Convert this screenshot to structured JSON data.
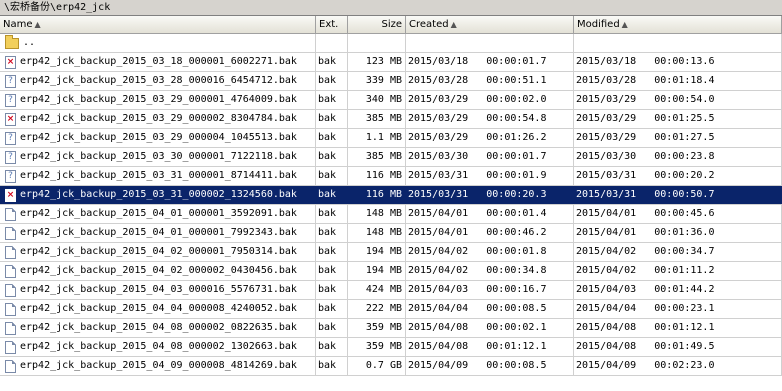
{
  "path": "\\宏桥备份\\erp42_jck",
  "headers": {
    "name": "Name",
    "ext": "Ext.",
    "size": "Size",
    "created": "Created",
    "modified": "Modified"
  },
  "up_dir": "..",
  "rows": [
    {
      "icon": "error-file-icon",
      "name": "erp42_jck_backup_2015_03_18_000001_6002271.bak",
      "ext": "bak",
      "size": "123 MB",
      "created": "2015/03/18   00:00:01.7",
      "modified": "2015/03/18   00:00:13.6"
    },
    {
      "icon": "unknown-file-icon",
      "name": "erp42_jck_backup_2015_03_28_000016_6454712.bak",
      "ext": "bak",
      "size": "339 MB",
      "created": "2015/03/28   00:00:51.1",
      "modified": "2015/03/28   00:01:18.4"
    },
    {
      "icon": "unknown-file-icon",
      "name": "erp42_jck_backup_2015_03_29_000001_4764009.bak",
      "ext": "bak",
      "size": "340 MB",
      "created": "2015/03/29   00:00:02.0",
      "modified": "2015/03/29   00:00:54.0"
    },
    {
      "icon": "error-file-icon",
      "name": "erp42_jck_backup_2015_03_29_000002_8304784.bak",
      "ext": "bak",
      "size": "385 MB",
      "created": "2015/03/29   00:00:54.8",
      "modified": "2015/03/29   00:01:25.5"
    },
    {
      "icon": "unknown-file-icon",
      "name": "erp42_jck_backup_2015_03_29_000004_1045513.bak",
      "ext": "bak",
      "size": "1.1 MB",
      "created": "2015/03/29   00:01:26.2",
      "modified": "2015/03/29   00:01:27.5"
    },
    {
      "icon": "unknown-file-icon",
      "name": "erp42_jck_backup_2015_03_30_000001_7122118.bak",
      "ext": "bak",
      "size": "385 MB",
      "created": "2015/03/30   00:00:01.7",
      "modified": "2015/03/30   00:00:23.8"
    },
    {
      "icon": "unknown-file-icon",
      "name": "erp42_jck_backup_2015_03_31_000001_8714411.bak",
      "ext": "bak",
      "size": "116 MB",
      "created": "2015/03/31   00:00:01.9",
      "modified": "2015/03/31   00:00:20.2"
    },
    {
      "icon": "error-file-icon",
      "name": "erp42_jck_backup_2015_03_31_000002_1324560.bak",
      "ext": "bak",
      "size": "116 MB",
      "created": "2015/03/31   00:00:20.3",
      "modified": "2015/03/31   00:00:50.7",
      "selected": true
    },
    {
      "icon": "file-icon",
      "name": "erp42_jck_backup_2015_04_01_000001_3592091.bak",
      "ext": "bak",
      "size": "148 MB",
      "created": "2015/04/01   00:00:01.4",
      "modified": "2015/04/01   00:00:45.6"
    },
    {
      "icon": "file-icon",
      "name": "erp42_jck_backup_2015_04_01_000001_7992343.bak",
      "ext": "bak",
      "size": "148 MB",
      "created": "2015/04/01   00:00:46.2",
      "modified": "2015/04/01   00:01:36.0"
    },
    {
      "icon": "file-icon",
      "name": "erp42_jck_backup_2015_04_02_000001_7950314.bak",
      "ext": "bak",
      "size": "194 MB",
      "created": "2015/04/02   00:00:01.8",
      "modified": "2015/04/02   00:00:34.7"
    },
    {
      "icon": "file-icon",
      "name": "erp42_jck_backup_2015_04_02_000002_0430456.bak",
      "ext": "bak",
      "size": "194 MB",
      "created": "2015/04/02   00:00:34.8",
      "modified": "2015/04/02   00:01:11.2"
    },
    {
      "icon": "file-icon",
      "name": "erp42_jck_backup_2015_04_03_000016_5576731.bak",
      "ext": "bak",
      "size": "424 MB",
      "created": "2015/04/03   00:00:16.7",
      "modified": "2015/04/03   00:01:44.2"
    },
    {
      "icon": "file-icon",
      "name": "erp42_jck_backup_2015_04_04_000008_4240052.bak",
      "ext": "bak",
      "size": "222 MB",
      "created": "2015/04/04   00:00:08.5",
      "modified": "2015/04/04   00:00:23.1"
    },
    {
      "icon": "file-icon",
      "name": "erp42_jck_backup_2015_04_08_000002_0822635.bak",
      "ext": "bak",
      "size": "359 MB",
      "created": "2015/04/08   00:00:02.1",
      "modified": "2015/04/08   00:01:12.1"
    },
    {
      "icon": "file-icon",
      "name": "erp42_jck_backup_2015_04_08_000002_1302663.bak",
      "ext": "bak",
      "size": "359 MB",
      "created": "2015/04/08   00:01:12.1",
      "modified": "2015/04/08   00:01:49.5"
    },
    {
      "icon": "file-icon",
      "name": "erp42_jck_backup_2015_04_09_000008_4814269.bak",
      "ext": "bak",
      "size": "0.7 GB",
      "created": "2015/04/09   00:00:08.5",
      "modified": "2015/04/09   00:02:23.0"
    }
  ],
  "colors": {
    "selection": "#0a246a",
    "header": "#ece9d8"
  }
}
